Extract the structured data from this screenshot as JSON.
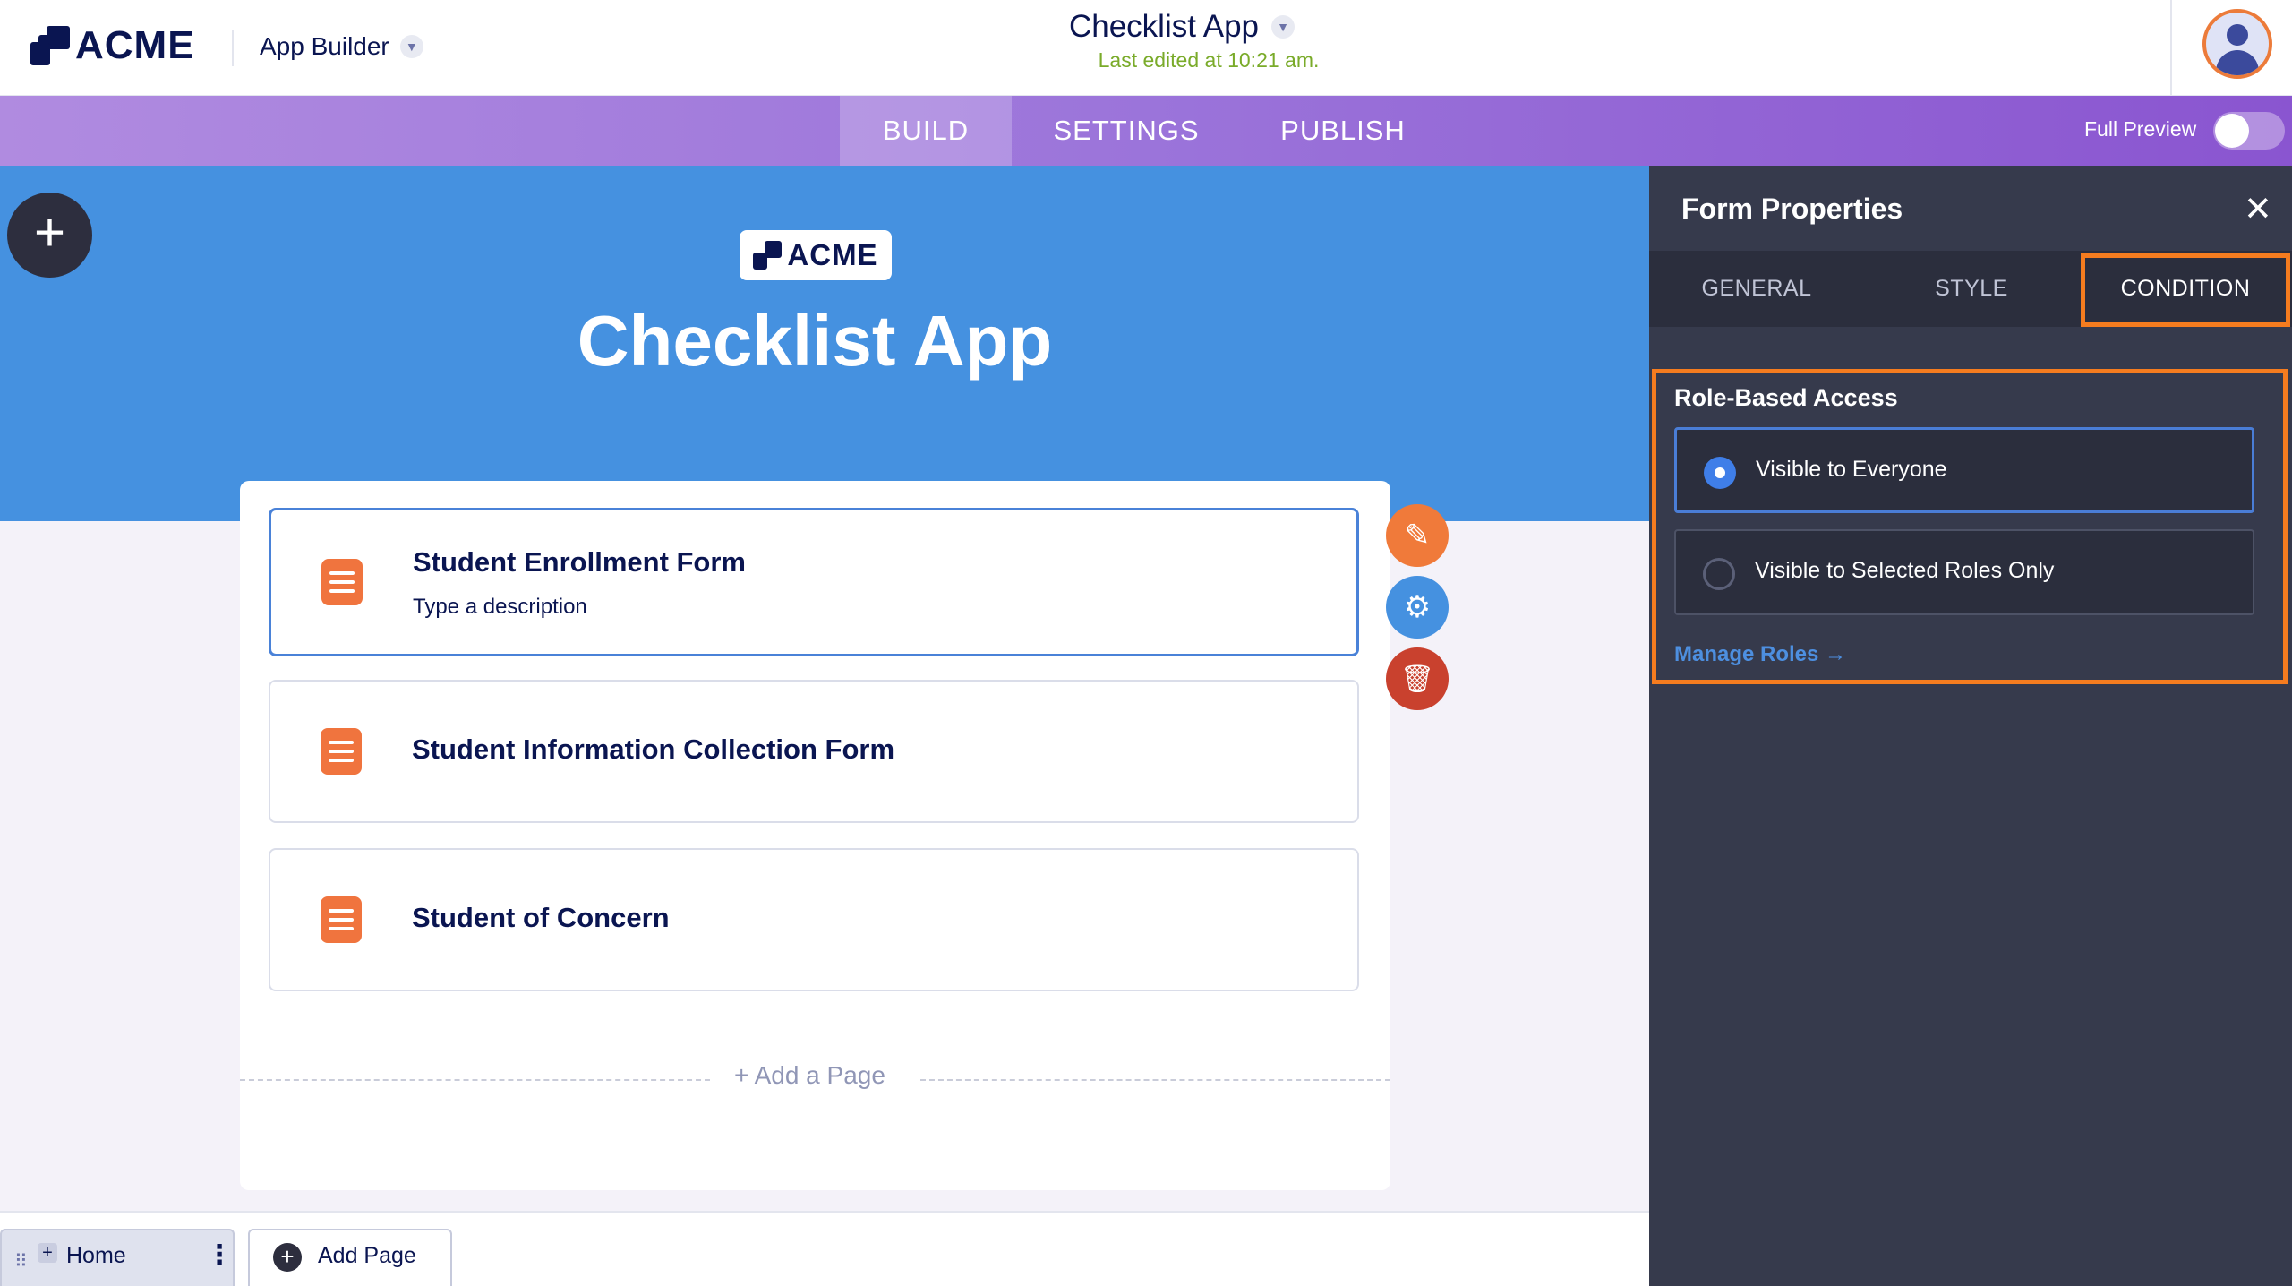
{
  "header": {
    "logo_text": "ACME",
    "builder_label": "App Builder",
    "app_title": "Checklist App",
    "last_edited": "Last edited at 10:21 am."
  },
  "nav": {
    "tabs": [
      "BUILD",
      "SETTINGS",
      "PUBLISH"
    ],
    "active_tab": "BUILD",
    "full_preview_label": "Full Preview",
    "full_preview_on": false
  },
  "canvas": {
    "hero_logo_text": "ACME",
    "hero_title": "Checklist App",
    "forms": [
      {
        "title": "Student Enrollment Form",
        "description": "Type a description",
        "selected": true
      },
      {
        "title": "Student Information Collection Form",
        "description": "",
        "selected": false
      },
      {
        "title": "Student of Concern",
        "description": "",
        "selected": false
      }
    ],
    "add_page_label": "+  Add a Page"
  },
  "bottom": {
    "pages": [
      {
        "label": "Home"
      }
    ],
    "add_page_label": "Add Page"
  },
  "panel": {
    "title": "Form Properties",
    "tabs": [
      "GENERAL",
      "STYLE",
      "CONDITION"
    ],
    "active_tab": "CONDITION",
    "section_title": "Role-Based Access",
    "options": [
      {
        "label": "Visible to Everyone",
        "selected": true
      },
      {
        "label": "Visible to Selected Roles Only",
        "selected": false
      }
    ],
    "manage_roles_label": "Manage Roles →"
  },
  "colors": {
    "accent_purple": "#9b74da",
    "hero_blue": "#4591e0",
    "form_icon_orange": "#f0743e",
    "highlight_orange": "#f57c1f",
    "edit_button": "#f07a3a",
    "settings_button": "#4591e0",
    "delete_button": "#c9412e",
    "last_edited_green": "#7aab2a"
  }
}
